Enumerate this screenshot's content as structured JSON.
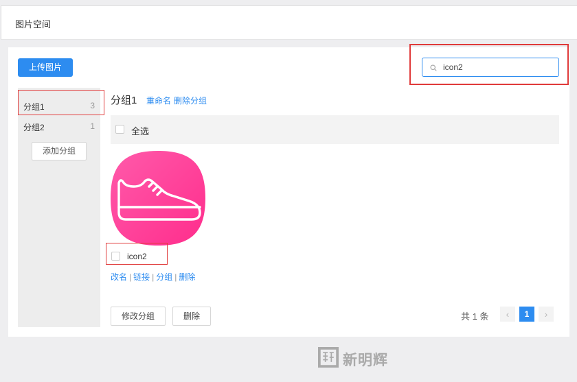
{
  "header": {
    "title": "图片空间"
  },
  "toolbar": {
    "upload_label": "上传图片",
    "search_value": "icon2",
    "search_icon": "search-icon"
  },
  "sidebar": {
    "groups": [
      {
        "name": "分组1",
        "count": "3"
      },
      {
        "name": "分组2",
        "count": "1"
      }
    ],
    "add_group_label": "添加分组"
  },
  "content": {
    "title": "分组1",
    "rename_label": "重命名",
    "delete_group_label": "删除分组",
    "select_all_label": "全选",
    "images": [
      {
        "name": "icon2",
        "icon": "shoe-icon",
        "actions": [
          "改名",
          "链接",
          "分组",
          "删除"
        ]
      }
    ],
    "modify_group_label": "修改分组",
    "delete_label": "删除"
  },
  "pager": {
    "total_text": "共 1 条",
    "current_page": "1",
    "prev_icon": "chevron-left-icon",
    "next_icon": "chevron-right-icon"
  },
  "watermark": {
    "text": "新明辉"
  },
  "colors": {
    "accent": "#2d8cf0",
    "highlight_box": "#e03a3a",
    "thumb_gradient_start": "#ff5aa8",
    "thumb_gradient_end": "#ff2e8b"
  }
}
